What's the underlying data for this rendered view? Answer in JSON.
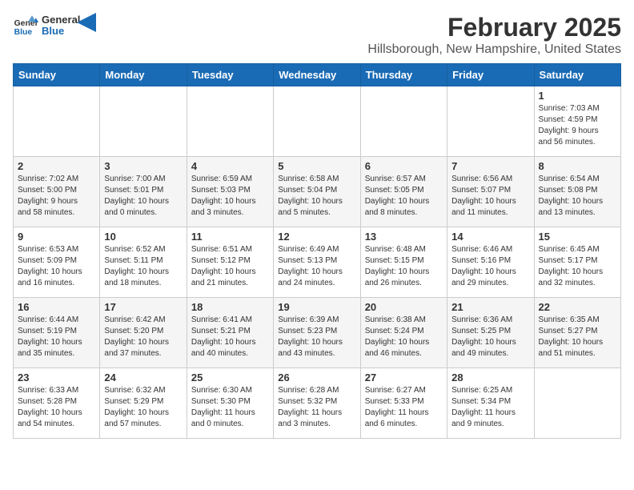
{
  "header": {
    "logo_line1": "General",
    "logo_line2": "Blue",
    "month_title": "February 2025",
    "location": "Hillsborough, New Hampshire, United States"
  },
  "weekdays": [
    "Sunday",
    "Monday",
    "Tuesday",
    "Wednesday",
    "Thursday",
    "Friday",
    "Saturday"
  ],
  "weeks": [
    [
      {
        "day": "",
        "info": ""
      },
      {
        "day": "",
        "info": ""
      },
      {
        "day": "",
        "info": ""
      },
      {
        "day": "",
        "info": ""
      },
      {
        "day": "",
        "info": ""
      },
      {
        "day": "",
        "info": ""
      },
      {
        "day": "1",
        "info": "Sunrise: 7:03 AM\nSunset: 4:59 PM\nDaylight: 9 hours\nand 56 minutes."
      }
    ],
    [
      {
        "day": "2",
        "info": "Sunrise: 7:02 AM\nSunset: 5:00 PM\nDaylight: 9 hours\nand 58 minutes."
      },
      {
        "day": "3",
        "info": "Sunrise: 7:00 AM\nSunset: 5:01 PM\nDaylight: 10 hours\nand 0 minutes."
      },
      {
        "day": "4",
        "info": "Sunrise: 6:59 AM\nSunset: 5:03 PM\nDaylight: 10 hours\nand 3 minutes."
      },
      {
        "day": "5",
        "info": "Sunrise: 6:58 AM\nSunset: 5:04 PM\nDaylight: 10 hours\nand 5 minutes."
      },
      {
        "day": "6",
        "info": "Sunrise: 6:57 AM\nSunset: 5:05 PM\nDaylight: 10 hours\nand 8 minutes."
      },
      {
        "day": "7",
        "info": "Sunrise: 6:56 AM\nSunset: 5:07 PM\nDaylight: 10 hours\nand 11 minutes."
      },
      {
        "day": "8",
        "info": "Sunrise: 6:54 AM\nSunset: 5:08 PM\nDaylight: 10 hours\nand 13 minutes."
      }
    ],
    [
      {
        "day": "9",
        "info": "Sunrise: 6:53 AM\nSunset: 5:09 PM\nDaylight: 10 hours\nand 16 minutes."
      },
      {
        "day": "10",
        "info": "Sunrise: 6:52 AM\nSunset: 5:11 PM\nDaylight: 10 hours\nand 18 minutes."
      },
      {
        "day": "11",
        "info": "Sunrise: 6:51 AM\nSunset: 5:12 PM\nDaylight: 10 hours\nand 21 minutes."
      },
      {
        "day": "12",
        "info": "Sunrise: 6:49 AM\nSunset: 5:13 PM\nDaylight: 10 hours\nand 24 minutes."
      },
      {
        "day": "13",
        "info": "Sunrise: 6:48 AM\nSunset: 5:15 PM\nDaylight: 10 hours\nand 26 minutes."
      },
      {
        "day": "14",
        "info": "Sunrise: 6:46 AM\nSunset: 5:16 PM\nDaylight: 10 hours\nand 29 minutes."
      },
      {
        "day": "15",
        "info": "Sunrise: 6:45 AM\nSunset: 5:17 PM\nDaylight: 10 hours\nand 32 minutes."
      }
    ],
    [
      {
        "day": "16",
        "info": "Sunrise: 6:44 AM\nSunset: 5:19 PM\nDaylight: 10 hours\nand 35 minutes."
      },
      {
        "day": "17",
        "info": "Sunrise: 6:42 AM\nSunset: 5:20 PM\nDaylight: 10 hours\nand 37 minutes."
      },
      {
        "day": "18",
        "info": "Sunrise: 6:41 AM\nSunset: 5:21 PM\nDaylight: 10 hours\nand 40 minutes."
      },
      {
        "day": "19",
        "info": "Sunrise: 6:39 AM\nSunset: 5:23 PM\nDaylight: 10 hours\nand 43 minutes."
      },
      {
        "day": "20",
        "info": "Sunrise: 6:38 AM\nSunset: 5:24 PM\nDaylight: 10 hours\nand 46 minutes."
      },
      {
        "day": "21",
        "info": "Sunrise: 6:36 AM\nSunset: 5:25 PM\nDaylight: 10 hours\nand 49 minutes."
      },
      {
        "day": "22",
        "info": "Sunrise: 6:35 AM\nSunset: 5:27 PM\nDaylight: 10 hours\nand 51 minutes."
      }
    ],
    [
      {
        "day": "23",
        "info": "Sunrise: 6:33 AM\nSunset: 5:28 PM\nDaylight: 10 hours\nand 54 minutes."
      },
      {
        "day": "24",
        "info": "Sunrise: 6:32 AM\nSunset: 5:29 PM\nDaylight: 10 hours\nand 57 minutes."
      },
      {
        "day": "25",
        "info": "Sunrise: 6:30 AM\nSunset: 5:30 PM\nDaylight: 11 hours\nand 0 minutes."
      },
      {
        "day": "26",
        "info": "Sunrise: 6:28 AM\nSunset: 5:32 PM\nDaylight: 11 hours\nand 3 minutes."
      },
      {
        "day": "27",
        "info": "Sunrise: 6:27 AM\nSunset: 5:33 PM\nDaylight: 11 hours\nand 6 minutes."
      },
      {
        "day": "28",
        "info": "Sunrise: 6:25 AM\nSunset: 5:34 PM\nDaylight: 11 hours\nand 9 minutes."
      },
      {
        "day": "",
        "info": ""
      }
    ]
  ]
}
